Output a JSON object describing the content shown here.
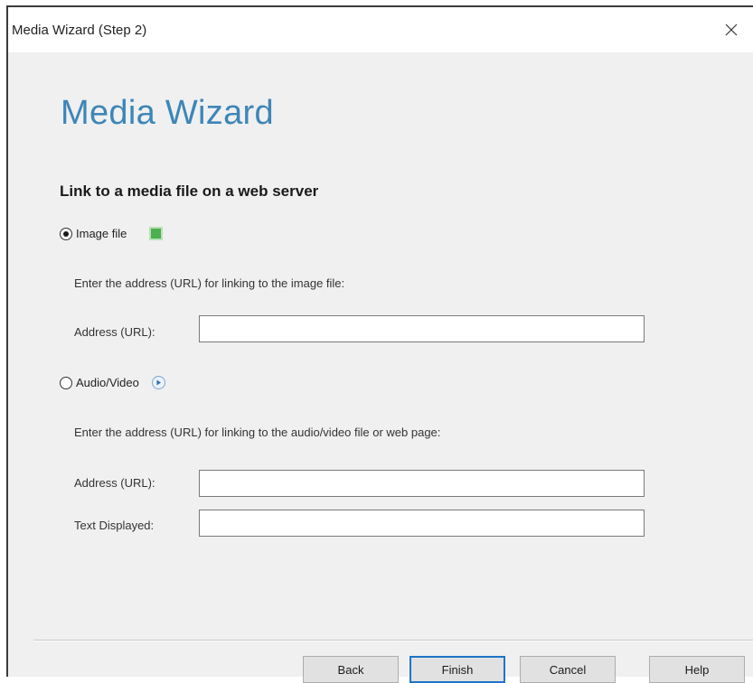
{
  "window": {
    "title": "Media Wizard (Step 2)",
    "close_glyph": "×"
  },
  "main": {
    "heading": "Media Wizard",
    "subheading": "Link to a media file on a web server"
  },
  "image_option": {
    "label": "Image file",
    "selected": true,
    "icon": "image-icon",
    "instruction": "Enter the address (URL) for linking to the image file:",
    "address_label": "Address (URL):",
    "address_value": ""
  },
  "av_option": {
    "label": "Audio/Video",
    "selected": false,
    "icon": "play-circle-icon",
    "instruction": "Enter the address (URL) for linking to the audio/video file or web page:",
    "address_label": "Address (URL):",
    "address_value": "",
    "text_label": "Text Displayed:",
    "text_value": ""
  },
  "buttons": {
    "back": "Back",
    "finish": "Finish",
    "cancel": "Cancel",
    "help": "Help"
  },
  "colors": {
    "heading": "#3d86b8",
    "default_button_border": "#1f74c8",
    "image_icon": "#4caf50"
  }
}
